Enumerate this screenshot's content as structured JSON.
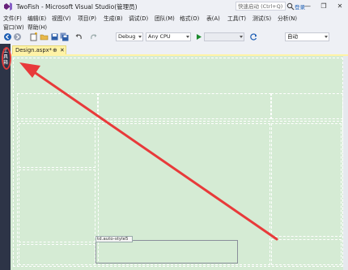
{
  "window": {
    "title": "TwoFish - Microsoft Visual Studio(管理员)",
    "search_placeholder": "快速启动 (Ctrl+Q)",
    "signin_label": "登录",
    "signin_placeholder_text": "",
    "minimize_glyph": "—",
    "restore_glyph": "❐",
    "close_glyph": "✕"
  },
  "menu": {
    "row1": [
      "文件(F)",
      "编辑(E)",
      "视图(V)",
      "项目(P)",
      "生成(B)",
      "调试(D)",
      "团队(M)",
      "格式(O)",
      "表(A)",
      "工具(T)",
      "测试(S)",
      "分析(N)"
    ],
    "row2": [
      "窗口(W)",
      "帮助(H)"
    ]
  },
  "toolbar": {
    "config": "Debug",
    "platform": "Any CPU",
    "mode": "自动",
    "icons": [
      "back-icon",
      "forward-icon",
      "new-project-icon",
      "open-file-icon",
      "save-icon",
      "save-all-icon",
      "undo-icon",
      "redo-icon",
      "start-icon",
      "refresh-icon"
    ]
  },
  "sidebar": {
    "label": "工具箱"
  },
  "tabs": [
    {
      "label": "Design.aspx*",
      "pin": "⊕",
      "close": "✕"
    }
  ],
  "designer": {
    "selected_tag": "td.auto-style5",
    "accent_color": "#d5ebd4",
    "annotation_color": "#e03a3a"
  }
}
